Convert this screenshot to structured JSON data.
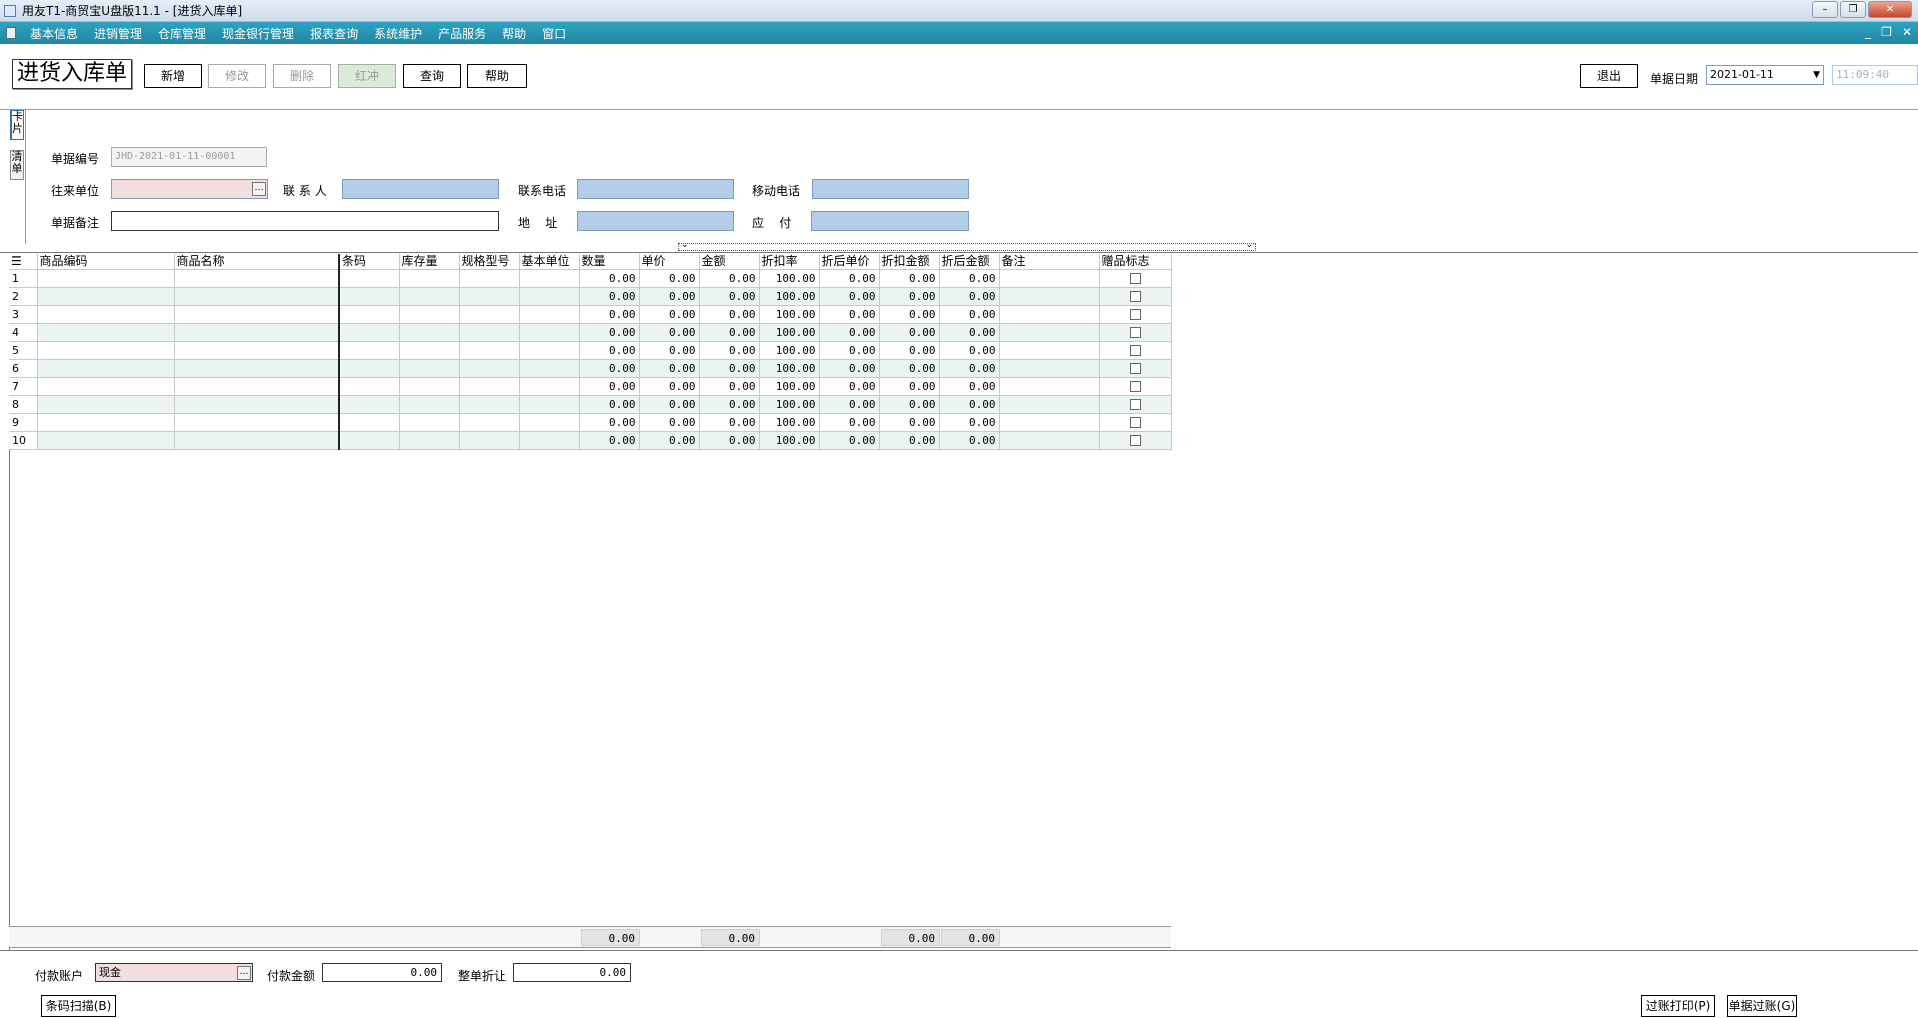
{
  "window": {
    "title": "用友T1-商贸宝U盘版11.1 - [进货入库单]"
  },
  "menu": [
    "基本信息",
    "进销管理",
    "仓库管理",
    "现金银行管理",
    "报表查询",
    "系统维护",
    "产品服务",
    "帮助",
    "窗口"
  ],
  "toolbar": {
    "doc_title": "进货入库单",
    "new_label": "新增",
    "edit_label": "修改",
    "delete_label": "删除",
    "redflush_label": "红冲",
    "query_label": "查询",
    "help_label": "帮助",
    "exit_label": "退出",
    "date_label": "单据日期",
    "date_value": "2021-01-11",
    "time_value": "11:09:40"
  },
  "side_tabs": [
    "卡片",
    "清单"
  ],
  "form": {
    "doc_no_label": "单据编号",
    "doc_no_value": "JHD-2021-01-11-00001",
    "partner_label": "往来单位",
    "contact_label": "联 系 人",
    "phone_label": "联系电话",
    "mobile_label": "移动电话",
    "remark_label": "单据备注",
    "address_label": "地    址",
    "payable_label": "应    付"
  },
  "grid": {
    "columns": [
      "商品编码",
      "商品名称",
      "条码",
      "库存量",
      "规格型号",
      "基本单位",
      "数量",
      "单价",
      "金额",
      "折扣率",
      "折后单价",
      "折扣金额",
      "折后金额",
      "备注",
      "赠品标志"
    ],
    "rows": [
      {
        "n": "1",
        "qty": "0.00",
        "price": "0.00",
        "amount": "0.00",
        "rate": "100.00",
        "dprice": "0.00",
        "damount": "0.00",
        "after": "0.00"
      },
      {
        "n": "2",
        "qty": "0.00",
        "price": "0.00",
        "amount": "0.00",
        "rate": "100.00",
        "dprice": "0.00",
        "damount": "0.00",
        "after": "0.00"
      },
      {
        "n": "3",
        "qty": "0.00",
        "price": "0.00",
        "amount": "0.00",
        "rate": "100.00",
        "dprice": "0.00",
        "damount": "0.00",
        "after": "0.00"
      },
      {
        "n": "4",
        "qty": "0.00",
        "price": "0.00",
        "amount": "0.00",
        "rate": "100.00",
        "dprice": "0.00",
        "damount": "0.00",
        "after": "0.00"
      },
      {
        "n": "5",
        "qty": "0.00",
        "price": "0.00",
        "amount": "0.00",
        "rate": "100.00",
        "dprice": "0.00",
        "damount": "0.00",
        "after": "0.00"
      },
      {
        "n": "6",
        "qty": "0.00",
        "price": "0.00",
        "amount": "0.00",
        "rate": "100.00",
        "dprice": "0.00",
        "damount": "0.00",
        "after": "0.00"
      },
      {
        "n": "7",
        "qty": "0.00",
        "price": "0.00",
        "amount": "0.00",
        "rate": "100.00",
        "dprice": "0.00",
        "damount": "0.00",
        "after": "0.00"
      },
      {
        "n": "8",
        "qty": "0.00",
        "price": "0.00",
        "amount": "0.00",
        "rate": "100.00",
        "dprice": "0.00",
        "damount": "0.00",
        "after": "0.00"
      },
      {
        "n": "9",
        "qty": "0.00",
        "price": "0.00",
        "amount": "0.00",
        "rate": "100.00",
        "dprice": "0.00",
        "damount": "0.00",
        "after": "0.00"
      },
      {
        "n": "10",
        "qty": "0.00",
        "price": "0.00",
        "amount": "0.00",
        "rate": "100.00",
        "dprice": "0.00",
        "damount": "0.00",
        "after": "0.00"
      }
    ],
    "totals": {
      "qty": "0.00",
      "amount": "0.00",
      "damount": "0.00",
      "after": "0.00"
    }
  },
  "payment": {
    "account_label": "付款账户",
    "account_value": "现金",
    "amount_label": "付款金额",
    "amount_value": "0.00",
    "discount_label": "整单折让",
    "discount_value": "0.00"
  },
  "bottom": {
    "scan_label": "条码扫描(B)",
    "post_print_label": "过账打印(P)",
    "post_label": "单据过账(G)"
  },
  "colors": {
    "menubar": "#1f86a4",
    "field_blue": "#b3cde8",
    "field_pink": "#f2dede",
    "row_alt": "#eaf5f3"
  }
}
